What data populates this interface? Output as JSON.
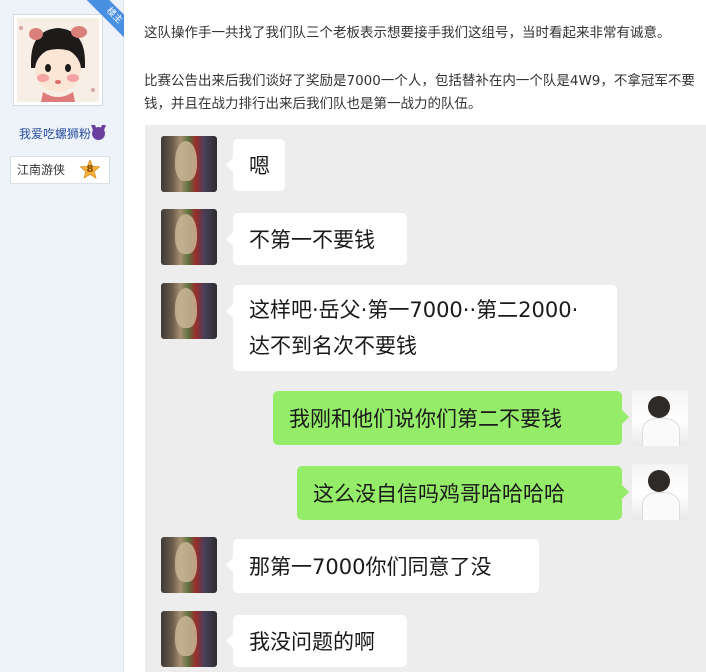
{
  "sidebar": {
    "username": "我爱吃螺狮粉",
    "title_label": "江南游侠",
    "level": "8",
    "corner_badge": "楼主"
  },
  "post": {
    "paragraph_1": "这队操作手一共找了我们队三个老板表示想要接手我们这组号，当时看起来非常有诚意。",
    "paragraph_2_line_1": "比赛公告出来后我们谈好了奖励是7000一个人，包括替补在内一个队是4W9，不拿冠军不要",
    "paragraph_2_line_2": "钱，并且在战力排行出来后我们队也是第一战力的队伍。"
  },
  "chat": {
    "messages": [
      {
        "side": "left",
        "lines": [
          "嗯"
        ]
      },
      {
        "side": "left",
        "lines": [
          "不第一不要钱"
        ]
      },
      {
        "side": "left",
        "lines": [
          "这样吧·岳父·第一7000··第二2000·",
          "达不到名次不要钱"
        ]
      },
      {
        "side": "right",
        "lines": [
          "我刚和他们说你们第二不要钱"
        ]
      },
      {
        "side": "right",
        "lines": [
          "这么没自信吗鸡哥哈哈哈哈"
        ]
      },
      {
        "side": "left",
        "lines": [
          "那第一7000你们同意了没"
        ]
      },
      {
        "side": "left",
        "lines": [
          "我没问题的啊"
        ]
      }
    ]
  },
  "colors": {
    "sidebar_bg": "#eef3fa",
    "username": "#2a4f9e",
    "chat_bg": "#ededed",
    "bubble_self": "#95ec69",
    "bubble_other": "#ffffff",
    "corner_badge": "#4a90e2"
  },
  "icons": {
    "level_badge": "star-badge-icon",
    "username_emoji": "devil-emoji-icon"
  }
}
